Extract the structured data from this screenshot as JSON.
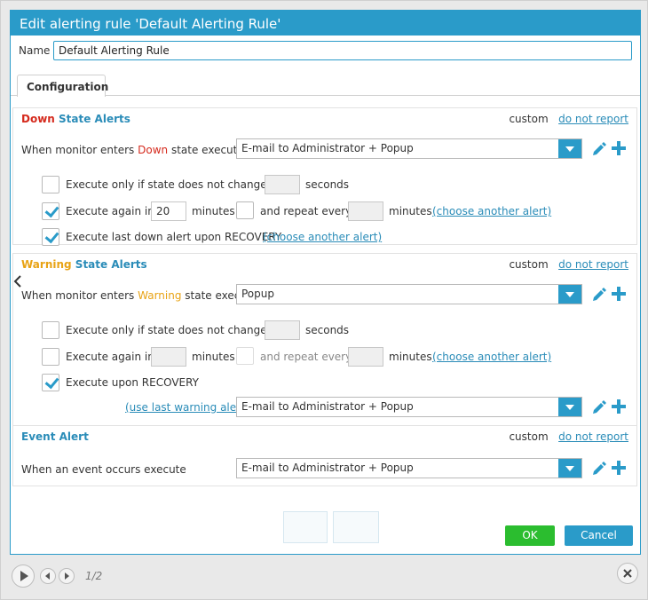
{
  "dialog": {
    "title": "Edit alerting rule 'Default Alerting Rule'",
    "name_label": "Name",
    "name_value": "Default Alerting Rule",
    "tab_label": "Configuration"
  },
  "down": {
    "title_part1": "Down",
    "title_part2": " State Alerts",
    "custom": "custom",
    "do_not_report": "do not report",
    "row_prefix": "When monitor enters ",
    "row_state": "Down",
    "row_suffix": " state execute",
    "select_value": "E-mail to Administrator + Popup",
    "opt1_label": "Execute only if state does not change for",
    "opt1_unit": "seconds",
    "opt1_checked": false,
    "opt2_label": "Execute again in",
    "opt2_value": "20",
    "opt2_unit": "minutes",
    "opt2_checked": true,
    "opt2_repeat": "and repeat every",
    "opt2_repeat_unit": "minutes",
    "opt2_choose": "(choose another alert)",
    "opt3_label": "Execute last down alert upon RECOVERY",
    "opt3_checked": true,
    "opt3_choose": "(choose another alert)"
  },
  "warning": {
    "title_part1": "Warning",
    "title_part2": " State Alerts",
    "custom": "custom",
    "do_not_report": "do not report",
    "row_prefix": "When monitor enters ",
    "row_state": "Warning",
    "row_suffix": " state execute",
    "select_value": "Popup",
    "opt1_label": "Execute only if state does not change for",
    "opt1_unit": "seconds",
    "opt2_label": "Execute again in",
    "opt2_unit": "minutes",
    "opt2_repeat": "and repeat every",
    "opt2_repeat_unit": "minutes",
    "opt2_choose": "(choose another alert)",
    "opt3_label": "Execute upon RECOVERY",
    "use_last": "(use last warning alert)",
    "recovery_select": "E-mail to Administrator + Popup"
  },
  "event": {
    "title": "Event Alert",
    "custom": "custom",
    "do_not_report": "do not report",
    "row_label": "When an event occurs execute",
    "select_value": "E-mail to Administrator + Popup"
  },
  "buttons": {
    "ok": "OK",
    "cancel": "Cancel"
  },
  "pager": "1/2",
  "colors": {
    "accent": "#2a9bc9",
    "down": "#d52a1d",
    "warning": "#e8a315",
    "ok": "#2bbd2f"
  },
  "icons": [
    "pencil-icon",
    "plus-icon",
    "chevron-down-icon",
    "chevron-left-icon",
    "play-icon",
    "prev-icon",
    "next-icon",
    "close-icon"
  ]
}
